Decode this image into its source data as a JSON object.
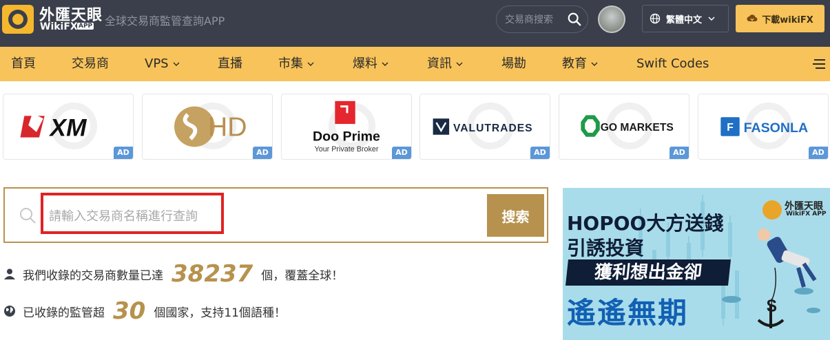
{
  "header": {
    "brand_cn": "外匯天眼",
    "brand_en": "WikiFX",
    "brand_app": "APP",
    "tagline": "全球交易商監管查詢APP",
    "search_placeholder": "交易商搜索",
    "language": "繁體中文",
    "download": "下載wikiFX"
  },
  "nav": {
    "items": [
      {
        "label": "首頁",
        "dropdown": false
      },
      {
        "label": "交易商",
        "dropdown": false
      },
      {
        "label": "VPS",
        "dropdown": true
      },
      {
        "label": "直播",
        "dropdown": false
      },
      {
        "label": "市集",
        "dropdown": true
      },
      {
        "label": "爆料",
        "dropdown": true
      },
      {
        "label": "資訊",
        "dropdown": true
      },
      {
        "label": "場勘",
        "dropdown": false
      },
      {
        "label": "教育",
        "dropdown": true
      },
      {
        "label": "Swift Codes",
        "dropdown": false
      }
    ]
  },
  "ads": [
    {
      "name": "XM",
      "badge": "AD"
    },
    {
      "name": "HD",
      "badge": "AD"
    },
    {
      "name": "Doo Prime",
      "sub": "Your Private Broker",
      "badge": "AD"
    },
    {
      "name": "VALUTRADES",
      "badge": "AD"
    },
    {
      "name": "GO MARKETS",
      "badge": "AD"
    },
    {
      "name": "FASONLA",
      "badge": "AD"
    }
  ],
  "search": {
    "placeholder": "請輸入交易商名稱進行查詢",
    "button": "搜索"
  },
  "stats": {
    "brokers_prefix": "我們收錄的交易商數量已達",
    "brokers_count": "38237",
    "brokers_suffix": "個，覆蓋全球！",
    "regulators_prefix": "已收錄的監管超",
    "regulators_count": "30",
    "regulators_suffix": "個國家，支持11個語種！"
  },
  "banner": {
    "logo_cn": "外匯天眼",
    "logo_en": "WikiFX APP",
    "line1": "HOPOO大方送錢",
    "line2": "引誘投資",
    "line3": "獲利想出金卻",
    "line4": "遙遙無期"
  },
  "colors": {
    "header_bg": "#3a3f4b",
    "nav_bg": "#f8c35a",
    "gold": "#b7924e",
    "ad_badge": "#5c97d8",
    "highlight_red": "#e02323"
  }
}
